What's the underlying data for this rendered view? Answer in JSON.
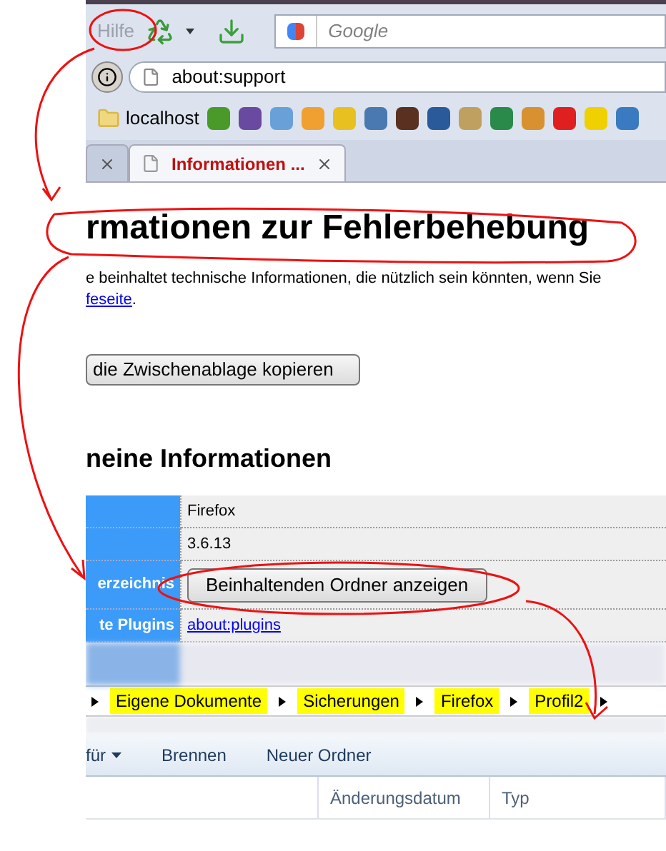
{
  "menu": {
    "label": "Hilfe",
    "disabled": true
  },
  "search": {
    "placeholder": "Google"
  },
  "address": {
    "value": "about:support"
  },
  "bookmarks": [
    {
      "label": "localhost"
    }
  ],
  "tabs": [
    {
      "selected": false
    },
    {
      "label": "Informationen ...",
      "selected": true
    }
  ],
  "page": {
    "heading": "rmationen zur Fehlerbehebung",
    "intro": "e beinhaltet technische Informationen, die nützlich sein könnten, wenn Sie",
    "link": "feseite",
    "link_tail": ".",
    "copy_button": "die Zwischenablage kopieren",
    "section": "neine Informationen",
    "rows": [
      {
        "kind": "text",
        "value": "Firefox"
      },
      {
        "kind": "text",
        "value": "3.6.13"
      },
      {
        "kind": "button",
        "label": "erzeichnis",
        "value": "Beinhaltenden Ordner anzeigen"
      },
      {
        "kind": "link",
        "label": "te Plugins",
        "value": "about:plugins"
      }
    ]
  },
  "explorer": {
    "breadcrumb": [
      {
        "label": "Eigene Dokumente"
      },
      {
        "label": "Sicherungen"
      },
      {
        "label": "Firefox"
      },
      {
        "label": "Profil2"
      }
    ],
    "toolbar": [
      {
        "label": "für",
        "dropdown": true
      },
      {
        "label": "Brennen",
        "dropdown": false
      },
      {
        "label": "Neuer Ordner",
        "dropdown": false
      }
    ],
    "columns": [
      "Änderungsdatum",
      "Typ"
    ]
  }
}
